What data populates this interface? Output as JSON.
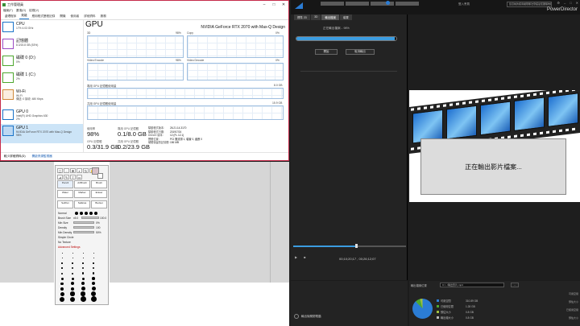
{
  "task_manager": {
    "title": "工作管理員",
    "menu": [
      "檔案(F)",
      "選項(O)",
      "檢視(V)"
    ],
    "tabs": [
      "處理程序",
      "效能",
      "應用程式歷程記錄",
      "開機",
      "使用者",
      "詳細資料",
      "服務"
    ],
    "active_tab": "效能",
    "devices": [
      {
        "name": "CPU",
        "sub": "17% 4.03 GHz",
        "color": "#1a73c8"
      },
      {
        "name": "記憶體",
        "sub": "8.3/15.8 GB (53%)",
        "color": "#9b4bc4"
      },
      {
        "name": "磁碟 0 (D:)",
        "sub": "0%",
        "color": "#4ea72e"
      },
      {
        "name": "磁碟 1 (C:)",
        "sub": "2%",
        "color": "#4ea72e"
      },
      {
        "name": "Wi-Fi",
        "sub": "Wi-Fi\n傳送: 0 接收: 480 Kbps",
        "color": "#d08a3c"
      },
      {
        "name": "GPU 0",
        "sub": "Intel(R) UHD Graphics 630\n2%",
        "color": "#1a73c8"
      },
      {
        "name": "GPU 1",
        "sub": "NVIDIA GeForce RTX 2070 with Max-Q Design\n98%",
        "color": "#1a73c8"
      }
    ],
    "gpu": {
      "title": "GPU",
      "model": "NVIDIA GeForce RTX 2070 with Max-Q Design",
      "engines": [
        "3D",
        "Copy",
        "Video Encode",
        "Video Decode"
      ],
      "pct": [
        "98%",
        "0%",
        "98%",
        "0%"
      ],
      "dedicated_label": "專用 GPU 記憶體使用量",
      "dedicated_max": "8.0 GB",
      "shared_label": "共用 GPU 記憶體使用量",
      "shared_max": "15.9 GB",
      "stats": {
        "util_label": "使用率",
        "util": "98%",
        "ded_label": "專用 GPU 記憶體",
        "ded": "0.1/8.0 GB",
        "gpu_mem_label": "GPU 記憶體",
        "gpu_mem": "0.3/31.9 GB",
        "shared_label": "共用 GPU 記憶體",
        "shared": "0.2/23.9 GB"
      },
      "details": {
        "keys": [
          "驅動程式版本:",
          "驅動程式日期:",
          "DirectX 版本:",
          "實體位置:",
          "硬體保留的記憶體:"
        ],
        "values": [
          "26.21.14.3170",
          "2019/7/24",
          "12 (FL 12.1)",
          "PCI 匯流排 1, 裝置 0, 函數 0",
          "156 MB"
        ]
      }
    },
    "footer": {
      "less_details": "較少詳細資料(D)",
      "open_monitor": "開啟資源監視器"
    }
  },
  "palette": {
    "labels": [
      "Normal",
      "Brush Size",
      "Min Size",
      "Density",
      "Min Density",
      "Simple Circle",
      "No Texture",
      "Advanced Settings"
    ],
    "values": [
      "x5.0",
      "100.0",
      "0%",
      "100",
      "50%"
    ],
    "tool_names": [
      "Pencil",
      "AirBrush",
      "Brush",
      "Water",
      "Marker",
      "Eraser",
      "SelPen",
      "SelEras",
      "Bucket"
    ]
  },
  "powerdirector": {
    "app_name": "PowerDirector",
    "top_link": "登入會員",
    "top_button": "您目前的使用權限無法發揮最佳硬體效能",
    "left_tabs": [
      "標準 2D",
      "3D",
      "輸出檔案",
      "裝置"
    ],
    "active_left_tab": "輸出檔案",
    "progress_label": "正在輸出檔案... 98%",
    "progress_pct": 98,
    "buttons": [
      "開始",
      "取消輸出"
    ],
    "message": "正在輸出影片檔案...",
    "timecode": "00;10;20;17 , 00;26;12;07",
    "scrub_pct": 55,
    "path_label": "輸出檔案位置",
    "path_value": "C:\\...\\輸出影片.mp4",
    "path_button": "...",
    "legend": [
      {
        "label": "可用空間",
        "value": "310.89 GB",
        "color": "#2b7cd4"
      },
      {
        "label": "已使用空間",
        "value": "1.28 GB",
        "color": "#4ea72e"
      },
      {
        "label": "預估大小",
        "value": "0.8 GB",
        "color": "#a0c040"
      },
      {
        "label": "輸出總大小",
        "value": "0.8 GB",
        "color": "#bbbbbb"
      }
    ],
    "summary": [
      "可用空間",
      "預估大小",
      "已使用空間",
      "預估大小"
    ],
    "checkbox_label": "輸出後關閉電腦"
  }
}
